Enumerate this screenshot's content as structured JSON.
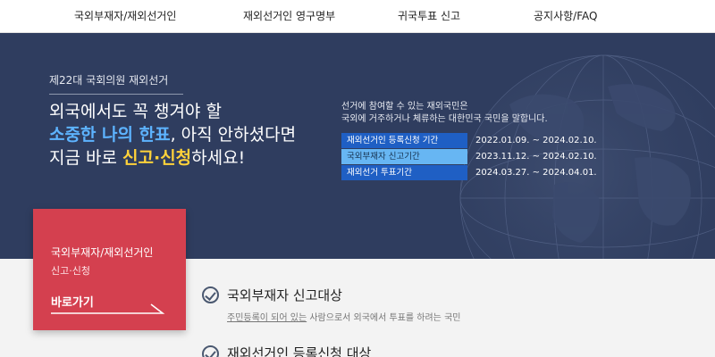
{
  "nav": {
    "items": [
      {
        "label": "국외부재자/재외선거인"
      },
      {
        "label": "재외선거인 영구명부"
      },
      {
        "label": "귀국투표 신고"
      },
      {
        "label": "공지사항/FAQ"
      }
    ]
  },
  "hero": {
    "election_tag": "제22대 국회의원 재외선거",
    "headline": {
      "line1": "외국에서도 꼭 챙겨야 할",
      "line2_highlight": "소중한 나의 한표",
      "line2_rest": ", 아직 안하셨다면",
      "line3_start": "지금 바로 ",
      "line3_highlight": "신고·신청",
      "line3_end": "하세요!"
    },
    "intro_line1": "선거에 참여할 수 있는 재외국민은",
    "intro_line2": "국외에 거주하거나 체류하는 대한민국 국민을 말합니다.",
    "schedule": [
      {
        "label": "재외선거인 등록신청 기간",
        "date": "2022.01.09. ~ 2024.02.10.",
        "bg": "#1f5fc4",
        "color": "#ffffff"
      },
      {
        "label": "국외부재자 신고기간",
        "date": "2023.11.12. ~ 2024.02.10.",
        "bg": "#67b6f3",
        "color": "#17324f"
      },
      {
        "label": "재외선거 투표기간",
        "date": "2024.03.27. ~ 2024.04.01.",
        "bg": "#1f5fc4",
        "color": "#ffffff"
      }
    ]
  },
  "card": {
    "title": "국외부재자/재외선거인",
    "subtitle": "신고·신청",
    "button": "바로가기"
  },
  "targets": [
    {
      "title_bold": "국외부재자",
      "title_rest": " 신고대상",
      "desc_underline": "주민등록이 되어 있는",
      "desc_rest": " 사람으로서 외국에서 투표를 하려는 국민"
    },
    {
      "title_bold": "재외선거인",
      "title_rest": " 등록신청 대상"
    }
  ],
  "colors": {
    "nav_bg": "#ffffff",
    "hero_bg": "#2f3d5f",
    "highlight_blue": "#5db3ff",
    "highlight_yellow": "#ffd23a",
    "card_red": "#d4404f",
    "lower_bg": "#f3f3f3"
  }
}
